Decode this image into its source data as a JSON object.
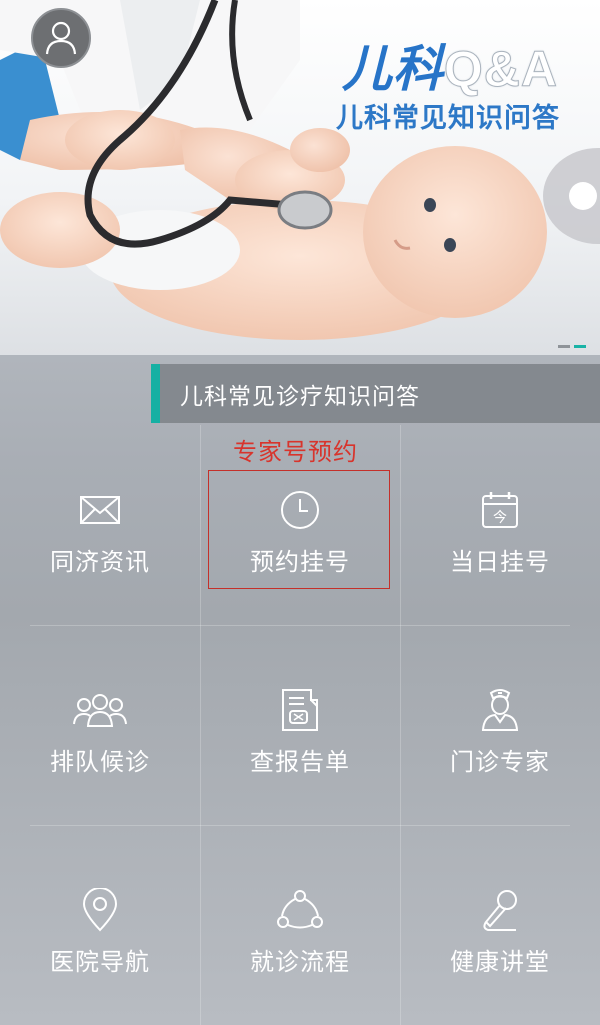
{
  "banner": {
    "logo_cn": "儿科",
    "logo_qa": "Q&A",
    "subtitle": "儿科常见知识问答"
  },
  "icons": {
    "avatar": "user-icon",
    "carousel": "carousel-next-knob"
  },
  "notice": {
    "text": "儿科常见诊疗知识问答"
  },
  "annotation": {
    "text": "专家号预约"
  },
  "menu": {
    "items": [
      {
        "label": "同济资讯",
        "icon": "envelope-icon"
      },
      {
        "label": "预约挂号",
        "icon": "clock-icon"
      },
      {
        "label": "当日挂号",
        "icon": "calendar-today-icon"
      },
      {
        "label": "排队候诊",
        "icon": "people-queue-icon"
      },
      {
        "label": "查报告单",
        "icon": "report-icon"
      },
      {
        "label": "门诊专家",
        "icon": "doctor-icon"
      },
      {
        "label": "医院导航",
        "icon": "location-pin-icon"
      },
      {
        "label": "就诊流程",
        "icon": "process-flow-icon"
      },
      {
        "label": "健康讲堂",
        "icon": "microphone-icon"
      }
    ]
  },
  "colors": {
    "accent": "#16b0a3",
    "logo_blue": "#2774c8",
    "annotation_red": "#d8342c"
  }
}
